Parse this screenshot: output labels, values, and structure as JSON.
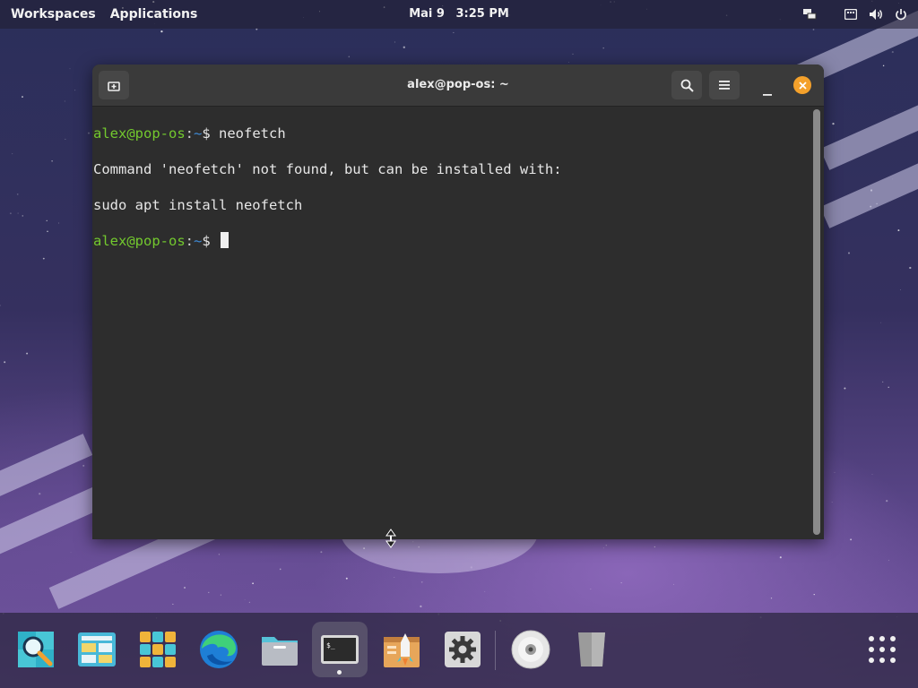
{
  "top_panel": {
    "workspaces_label": "Workspaces",
    "applications_label": "Applications",
    "date": "Mai 9",
    "time": "3:25 PM"
  },
  "terminal": {
    "title": "alex@pop-os: ~",
    "lines": [
      {
        "user": "alex@pop-os",
        "sep": ":",
        "path": "~",
        "dollar": "$ ",
        "cmd": "neofetch"
      },
      {
        "text": "Command 'neofetch' not found, but can be installed with:"
      },
      {
        "text": "sudo apt install neofetch"
      },
      {
        "user": "alex@pop-os",
        "sep": ":",
        "path": "~",
        "dollar": "$ ",
        "cmd": ""
      }
    ],
    "colors": {
      "user": "#73c92e",
      "path": "#3f8ad6",
      "close": "#f4a12b"
    }
  },
  "dock": {
    "items": [
      {
        "name": "launcher",
        "icon": "search-magnifier-icon"
      },
      {
        "name": "workspaces",
        "icon": "workspaces-icon"
      },
      {
        "name": "applications",
        "icon": "app-grid-icon"
      },
      {
        "name": "edge",
        "icon": "edge-browser-icon"
      },
      {
        "name": "files",
        "icon": "folder-icon"
      },
      {
        "name": "terminal",
        "icon": "terminal-icon",
        "active": true
      },
      {
        "name": "pop-shop",
        "icon": "pop-shop-icon"
      },
      {
        "name": "settings",
        "icon": "gear-icon"
      },
      {
        "name": "disc",
        "icon": "optical-disc-icon"
      },
      {
        "name": "trash",
        "icon": "trash-icon"
      },
      {
        "name": "show-apps",
        "icon": "grid-dots-icon"
      }
    ]
  }
}
